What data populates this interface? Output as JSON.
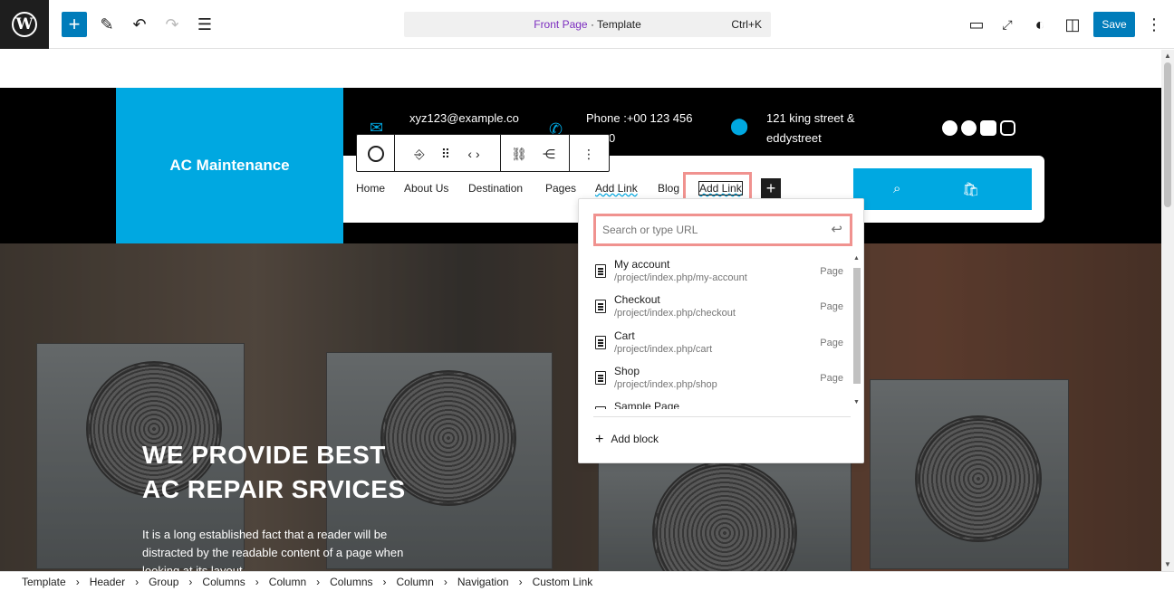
{
  "topbar": {
    "doc_title_page": "Front Page",
    "doc_title_rest": " · Template",
    "shortcut": "Ctrl+K",
    "save_label": "Save",
    "icons": [
      "wordpress-icon",
      "plus-icon",
      "pencil-icon",
      "undo-icon",
      "redo-icon",
      "list-view-icon",
      "desktop-icon",
      "external-icon",
      "contrast-icon",
      "sidebar-icon",
      "more-vertical-icon"
    ]
  },
  "header": {
    "brand": "AC Maintenance",
    "email": "xyz123@example.co",
    "phone_line1": "Phone :+00 123 456",
    "phone_line2": "0",
    "address_line1": "121 king street &",
    "address_line2": "eddystreet",
    "accent_color": "#00a8e1"
  },
  "nav": {
    "items": [
      "Home",
      "About Us",
      "Destination",
      "Pages",
      "Add Link",
      "Blog"
    ],
    "selected": "Add Link"
  },
  "hero": {
    "title_line1": "WE PROVIDE BEST",
    "title_line2": "AC REPAIR SRVICES",
    "text": "It is a long established fact that a reader will be distracted by the readable content of a page when looking at its layout."
  },
  "popover": {
    "search_placeholder": "Search or type URL",
    "results": [
      {
        "name": "My account",
        "url": "/project/index.php/my-account",
        "type": "Page"
      },
      {
        "name": "Checkout",
        "url": "/project/index.php/checkout",
        "type": "Page"
      },
      {
        "name": "Cart",
        "url": "/project/index.php/cart",
        "type": "Page"
      },
      {
        "name": "Shop",
        "url": "/project/index.php/shop",
        "type": "Page"
      },
      {
        "name": "Sample Page",
        "url": "",
        "type": ""
      }
    ],
    "add_block": "Add block"
  },
  "breadcrumb": [
    "Template",
    "Header",
    "Group",
    "Columns",
    "Column",
    "Columns",
    "Column",
    "Navigation",
    "Custom Link"
  ],
  "colors": {
    "wp_blue": "#007cba",
    "highlight": "#f0928f",
    "doc_title_accent": "#7b2cbf"
  }
}
